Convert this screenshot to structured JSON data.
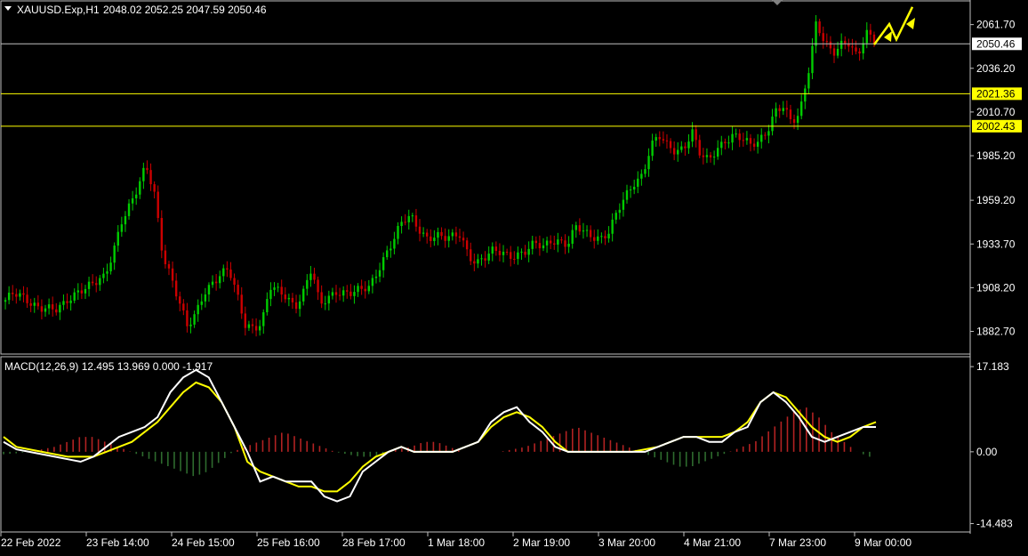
{
  "header": {
    "symbol": "XAUUSD.Exp,H1",
    "ohlc": "2048.02 2052.25 2047.59 2050.46"
  },
  "indicator": {
    "label": "MACD(12,26,9) 12.495 13.969 0.000 -1.917"
  },
  "colors": {
    "background": "#000000",
    "bull_candle": "#00cc00",
    "bear_candle": "#cc0000",
    "macd_line": "#ffffff",
    "signal_line": "#ffff00",
    "hist_positive": "#b22222",
    "hist_negative": "#2e6b2e",
    "level_line": "#ffff00",
    "price_line": "#c0c0c0",
    "axis_text": "#ffffff"
  },
  "chart_data": [
    {
      "type": "candlestick",
      "title": "XAUUSD.Exp,H1",
      "ylim": [
        1870,
        2075
      ],
      "y_ticks": [
        "2061.70",
        "2036.20",
        "2010.70",
        "1985.20",
        "1959.20",
        "1933.70",
        "1908.20",
        "1882.70"
      ],
      "y_tick_values": [
        2061.7,
        2036.2,
        2010.7,
        1985.2,
        1959.2,
        1933.7,
        1908.2,
        1882.7
      ],
      "current_price": "2050.46",
      "current_price_value": 2050.46,
      "levels": [
        {
          "label": "2021.36",
          "value": 2021.36
        },
        {
          "label": "2002.43",
          "value": 2002.43
        }
      ],
      "x_ticks": [
        "22 Feb 2022",
        "23 Feb 14:00",
        "24 Feb 15:00",
        "25 Feb 16:00",
        "28 Feb 17:00",
        "1 Mar 18:00",
        "2 Mar 19:00",
        "3 Mar 20:00",
        "4 Mar 21:00",
        "7 Mar 23:00",
        "9 Mar 00:00"
      ],
      "close_path": [
        1901,
        1904,
        1902,
        1900,
        1898,
        1897,
        1894,
        1897,
        1903,
        1908,
        1910,
        1911,
        1913,
        1928,
        1948,
        1957,
        1966,
        1978,
        1963,
        1929,
        1916,
        1900,
        1884,
        1892,
        1906,
        1912,
        1916,
        1918,
        1903,
        1887,
        1886,
        1888,
        1908,
        1905,
        1903,
        1898,
        1906,
        1919,
        1897,
        1902,
        1907,
        1906,
        1905,
        1906,
        1908,
        1919,
        1929,
        1937,
        1946,
        1949,
        1943,
        1938,
        1939,
        1936,
        1937,
        1940,
        1928,
        1923,
        1925,
        1929,
        1929,
        1928,
        1928,
        1929,
        1933,
        1932,
        1937,
        1936,
        1933,
        1943,
        1940,
        1939,
        1938,
        1941,
        1952,
        1961,
        1970,
        1975,
        1991,
        1996,
        1990,
        1988,
        1991,
        2000,
        1985,
        1981,
        1989,
        1995,
        1998,
        1995,
        1990,
        1993,
        2000,
        2012,
        2014,
        2003,
        2009,
        2034,
        2064,
        2052,
        2043,
        2049,
        2052,
        2044,
        2058,
        2050.46
      ],
      "macd": {
        "ylim": [
          -16,
          19
        ],
        "y_ticks": [
          "17.183",
          "0.00",
          "-14.483"
        ],
        "y_tick_values": [
          17.183,
          0,
          -14.483
        ],
        "macd_line": [
          2,
          0.5,
          0,
          -0.5,
          -1,
          -1.5,
          -2,
          -1,
          1,
          3,
          4,
          5,
          7,
          12,
          15,
          16.5,
          15,
          10,
          5,
          0,
          -6,
          -5,
          -6,
          -6,
          -6,
          -9,
          -10,
          -9,
          -4,
          -2,
          0,
          1,
          0,
          0,
          0,
          0,
          1,
          2,
          6,
          8,
          9,
          6,
          4,
          1,
          0,
          0,
          0,
          0,
          0,
          0,
          0,
          1,
          2,
          3,
          3,
          2,
          2,
          4,
          5,
          10,
          12,
          10,
          7,
          3,
          2,
          3,
          4,
          5,
          5
        ],
        "signal_line": [
          3,
          1,
          0.5,
          0,
          -0.5,
          -1,
          -1,
          -1,
          0,
          1,
          2,
          4,
          6,
          9,
          12,
          14,
          13,
          10,
          5,
          -2,
          -4,
          -5,
          -6,
          -7,
          -7,
          -8,
          -8,
          -6,
          -3,
          -1,
          0,
          1,
          0,
          0,
          0,
          0,
          1,
          2,
          5,
          7,
          8,
          7,
          5,
          2,
          0,
          0,
          0,
          0,
          0,
          0,
          0.5,
          1,
          2,
          3,
          3,
          3,
          3,
          4,
          6,
          10,
          12,
          11,
          8,
          5,
          3,
          2,
          3,
          5,
          6
        ],
        "histogram": [
          -0.5,
          -0.3,
          0,
          0.5,
          1,
          2,
          3,
          3,
          2,
          1,
          0,
          -1,
          -2,
          -3,
          -4,
          -5,
          -4,
          -2,
          0,
          1,
          2,
          3,
          4,
          3,
          2,
          1,
          0,
          -0.5,
          -1,
          -1,
          0,
          0.5,
          1,
          2,
          2,
          1,
          0,
          0,
          0,
          0,
          0.5,
          1,
          2,
          3,
          4,
          5,
          4,
          3,
          2,
          1,
          0,
          -1,
          -2,
          -3,
          -3,
          -2,
          -1,
          0,
          1,
          2,
          4,
          6,
          8,
          9,
          7,
          4,
          2,
          0,
          -1
        ]
      }
    }
  ],
  "annotations": {
    "arrows": "yellow-forecast-arrows"
  }
}
